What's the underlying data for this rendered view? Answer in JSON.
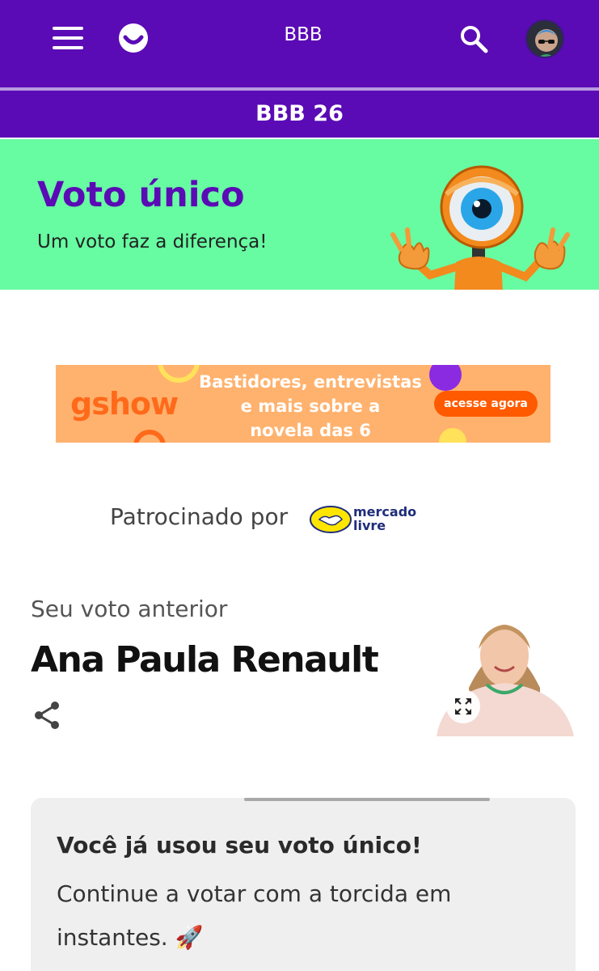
{
  "header": {
    "title": "BBB",
    "subtitle": "BBB 26",
    "menu_icon": "hamburger-menu-icon",
    "logo_icon": "globo-smile-logo",
    "search_icon": "search-icon",
    "avatar_icon": "user-avatar"
  },
  "banner": {
    "title": "Voto único",
    "subtitle": "Um voto faz a diferença!",
    "background_color": "#67fba2",
    "title_color": "#5a0bb5"
  },
  "ad": {
    "brand": "gshow",
    "lines": [
      "Bastidores, entrevistas",
      "e mais sobre a",
      "novela das 6"
    ],
    "cta": "acesse agora"
  },
  "sponsor": {
    "label": "Patrocinado por",
    "brand_line1": "mercado",
    "brand_line2": "livre"
  },
  "previous_vote": {
    "label": "Seu voto anterior",
    "name": "Ana Paula Renault",
    "share_icon": "share-icon",
    "expand_icon": "expand-icon"
  },
  "info_card": {
    "title": "Você já usou seu voto único!",
    "body": "Continue a votar com a torcida em instantes. 🚀"
  },
  "colors": {
    "brand_purple": "#5a0bb5",
    "banner_green": "#67fba2",
    "ad_orange": "#ffb26e",
    "cta_orange": "#ff5a00"
  }
}
